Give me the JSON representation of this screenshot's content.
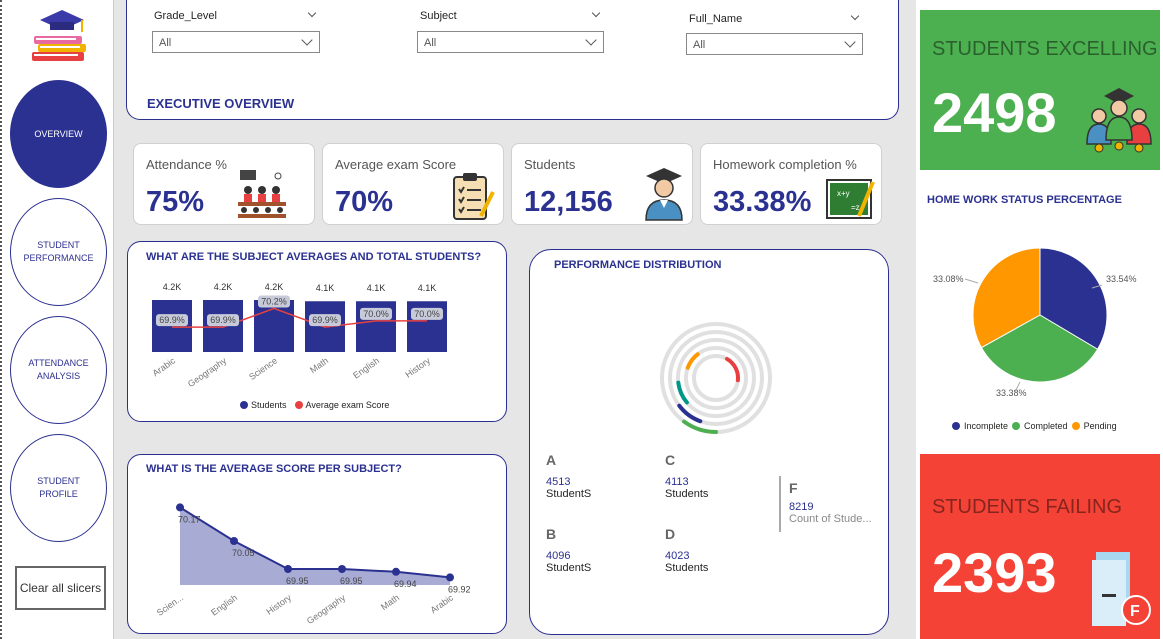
{
  "nav": {
    "items": [
      {
        "label": "OVERVIEW"
      },
      {
        "label": "STUDENT PERFORMANCE"
      },
      {
        "label": "ATTENDANCE ANALYSIS"
      },
      {
        "label": "STUDENT PROFILE"
      }
    ],
    "clear_label": "Clear all slicers"
  },
  "slicers": [
    {
      "label": "Grade_Level",
      "value": "All"
    },
    {
      "label": "Subject",
      "value": "All"
    },
    {
      "label": "Full_Name",
      "value": "All"
    }
  ],
  "header": {
    "title": "EXECUTIVE OVERVIEW"
  },
  "kpis": [
    {
      "title": "Attendance %",
      "value": "75%",
      "icon": "classroom-icon"
    },
    {
      "title": "Average exam Score",
      "value": "70%",
      "icon": "clipboard-icon"
    },
    {
      "title": "Students",
      "value": "12,156",
      "icon": "graduate-icon"
    },
    {
      "title": "Homework completion %",
      "value": "33.38%",
      "icon": "blackboard-icon"
    }
  ],
  "excelling": {
    "title": "STUDENTS EXCELLING",
    "value": "2498",
    "color": "#4caf50"
  },
  "failing": {
    "title": "STUDENTS FAILING",
    "value": "2393",
    "color": "#f44336"
  },
  "subject_chart": {
    "title": "WHAT ARE THE SUBJECT AVERAGES AND TOTAL STUDENTS?",
    "legend": [
      "Students",
      "Average exam Score"
    ]
  },
  "avg_chart": {
    "title": "WHAT IS THE AVERAGE SCORE PER SUBJECT?"
  },
  "perf": {
    "title": "PERFORMANCE DISTRIBUTION",
    "grades": [
      {
        "grade": "A",
        "count": "4513",
        "label": "StudentS"
      },
      {
        "grade": "C",
        "count": "4113",
        "label": "Students"
      },
      {
        "grade": "B",
        "count": "4096",
        "label": "StudentS"
      },
      {
        "grade": "D",
        "count": "4023",
        "label": "Students"
      },
      {
        "grade": "F",
        "count": "8219",
        "label": "Count of Stude..."
      }
    ]
  },
  "homework": {
    "title": "HOME WORK STATUS PERCENTAGE",
    "legend": [
      "Incomplete",
      "Completed",
      "Pending"
    ]
  },
  "chart_data": [
    {
      "type": "bar",
      "title": "WHAT ARE THE SUBJECT AVERAGES AND TOTAL STUDENTS?",
      "categories": [
        "Arabic",
        "Geography",
        "Science",
        "Math",
        "English",
        "History"
      ],
      "series": [
        {
          "name": "Students",
          "values": [
            4200,
            4200,
            4200,
            4100,
            4100,
            4100
          ],
          "labels": [
            "4.2K",
            "4.2K",
            "4.2K",
            "4.1K",
            "4.1K",
            "4.1K"
          ],
          "color": "#2b3190"
        },
        {
          "name": "Average exam Score",
          "type": "line",
          "values": [
            69.9,
            69.9,
            70.2,
            69.9,
            70.0,
            70.0
          ],
          "labels": [
            "69.9%",
            "69.9%",
            "70.2%",
            "69.9%",
            "70.0%",
            "70.0%"
          ],
          "color": "#e84040"
        }
      ]
    },
    {
      "type": "area",
      "title": "WHAT IS THE AVERAGE SCORE PER SUBJECT?",
      "categories": [
        "Scien...",
        "English",
        "History",
        "Geography",
        "Math",
        "Arabic"
      ],
      "values": [
        70.17,
        70.05,
        69.95,
        69.95,
        69.94,
        69.92
      ],
      "color": "#2b3190"
    },
    {
      "type": "pie",
      "title": "HOME WORK STATUS PERCENTAGE",
      "categories": [
        "Incomplete",
        "Completed",
        "Pending"
      ],
      "values": [
        33.54,
        33.38,
        33.08
      ],
      "labels": [
        "33.54%",
        "33.38%",
        "33.08%"
      ],
      "colors": [
        "#2b3190",
        "#4caf50",
        "#ff9800"
      ]
    },
    {
      "type": "radial",
      "title": "PERFORMANCE DISTRIBUTION",
      "categories": [
        "A",
        "B",
        "C",
        "D",
        "F"
      ],
      "values": [
        4513,
        4096,
        4113,
        4023,
        8219
      ],
      "colors": [
        "#4caf50",
        "#2b3190",
        "#009688",
        "#ff9800",
        "#e84040"
      ]
    }
  ]
}
